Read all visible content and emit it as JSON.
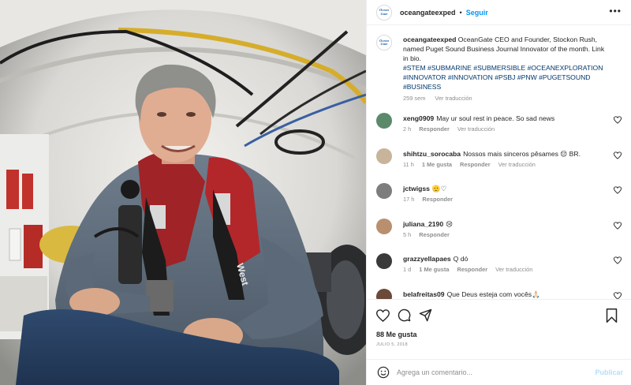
{
  "header": {
    "username": "oceangateexped",
    "separator": "•",
    "follow_label": "Seguir",
    "more_label": "•••",
    "logo_lines": [
      "Ocean",
      "Gate"
    ]
  },
  "caption": {
    "username": "oceangateexped",
    "text": "OceanGate CEO and Founder, Stockon Rush, named Puget Sound Business Journal Innovator of the month. Link in bio.",
    "hashtags": "#STEM #SUBMARINE #SUBMERSIBLE #OCEANEXPLORATION #INNOVATOR #INNOVATION #PSBJ #PNW #PUGETSOUND #BUSINESS",
    "age": "259 sem",
    "translate": "Ver traducción"
  },
  "comments": [
    {
      "user": "xeng0909",
      "text": "May ur soul rest in peace. So sad news",
      "age": "2 h",
      "likes": "",
      "reply": "Responder",
      "translate": "Ver traducción",
      "avatar_color": "#5a8a6a"
    },
    {
      "user": "shihtzu_sorocaba",
      "text": "Nossos mais sinceros pêsames 😔 BR.",
      "age": "11 h",
      "likes": "1 Me gusta",
      "reply": "Responder",
      "translate": "Ver traducción",
      "avatar_color": "#c8b49a"
    },
    {
      "user": "jctwigss",
      "text": "🫡♡",
      "age": "17 h",
      "likes": "",
      "reply": "Responder",
      "translate": "",
      "avatar_color": "#7d7d7d"
    },
    {
      "user": "juliana_2190",
      "text": "😢",
      "age": "5 h",
      "likes": "",
      "reply": "Responder",
      "translate": "",
      "avatar_color": "#b89070"
    },
    {
      "user": "grazzyellapaes",
      "text": "Q dó",
      "age": "1 d",
      "likes": "1 Me gusta",
      "reply": "Responder",
      "translate": "Ver traducción",
      "avatar_color": "#3a3a3a"
    },
    {
      "user": "belafreitas09",
      "text": "Que Deus esteja com vocês🙏🏻",
      "age": "",
      "likes": "",
      "reply": "",
      "translate": "",
      "avatar_color": "#6b4a3a"
    }
  ],
  "actions": {
    "like_icon": "heart-icon",
    "comment_icon": "comment-icon",
    "share_icon": "send-icon",
    "save_icon": "bookmark-icon"
  },
  "likes_text": "88 Me gusta",
  "date_text": "JULIO 5, 2018",
  "add_comment": {
    "placeholder": "Agrega un comentario...",
    "post_label": "Publicar"
  },
  "colors": {
    "accent": "#0095f6",
    "hashtag": "#00376b",
    "muted": "#8e8e8e",
    "post_disabled": "#b2dffc"
  }
}
